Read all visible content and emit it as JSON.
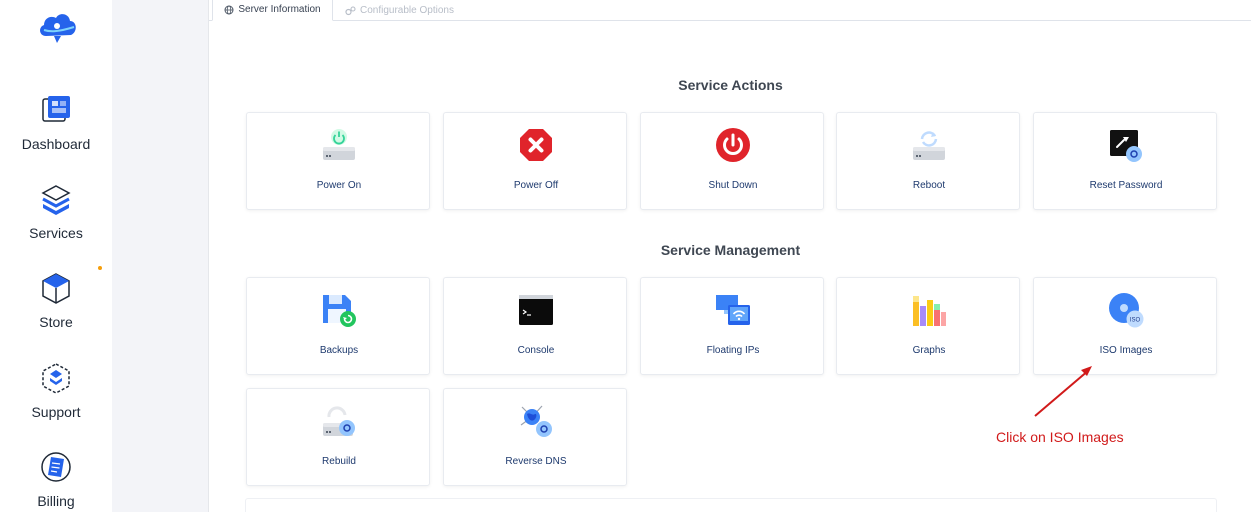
{
  "sidebar": {
    "items": [
      {
        "label": "Dashboard",
        "icon": "dashboard-icon"
      },
      {
        "label": "Services",
        "icon": "services-icon"
      },
      {
        "label": "Store",
        "icon": "store-icon"
      },
      {
        "label": "Support",
        "icon": "support-icon"
      },
      {
        "label": "Billing",
        "icon": "billing-icon"
      }
    ]
  },
  "tabs": [
    {
      "label": "Server Information",
      "icon": "globe-icon",
      "active": true
    },
    {
      "label": "Configurable Options",
      "icon": "cogs-icon",
      "active": false
    }
  ],
  "service_actions": {
    "title": "Service Actions",
    "cards": [
      {
        "label": "Power On",
        "icon": "power-on-icon"
      },
      {
        "label": "Power Off",
        "icon": "power-off-icon"
      },
      {
        "label": "Shut Down",
        "icon": "shut-down-icon"
      },
      {
        "label": "Reboot",
        "icon": "reboot-icon"
      },
      {
        "label": "Reset Password",
        "icon": "reset-password-icon"
      }
    ]
  },
  "service_management": {
    "title": "Service Management",
    "cards": [
      {
        "label": "Backups",
        "icon": "backups-icon"
      },
      {
        "label": "Console",
        "icon": "console-icon"
      },
      {
        "label": "Floating IPs",
        "icon": "floating-ips-icon"
      },
      {
        "label": "Graphs",
        "icon": "graphs-icon"
      },
      {
        "label": "ISO Images",
        "icon": "iso-images-icon",
        "icon_text": "ISO"
      },
      {
        "label": "Rebuild",
        "icon": "rebuild-icon"
      },
      {
        "label": "Reverse DNS",
        "icon": "reverse-dns-icon"
      }
    ]
  },
  "annotation": {
    "text": "Click on ISO Images",
    "color": "#d11a1a"
  },
  "colors": {
    "accent": "#2563eb",
    "danger": "#e0242b",
    "label": "#1e3a6e"
  }
}
